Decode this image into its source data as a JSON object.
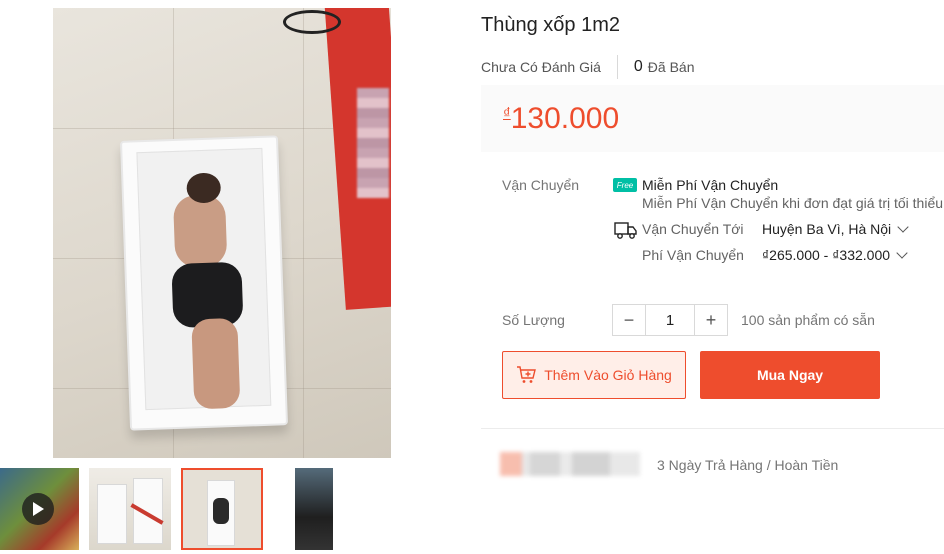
{
  "product": {
    "title": "Thùng xốp 1m2",
    "rating_text": "Chưa Có Đánh Giá",
    "sold_count": "0",
    "sold_label": "Đã Bán",
    "currency_symbol": "₫",
    "price": "130.000"
  },
  "shipping": {
    "label": "Vận Chuyển",
    "free_badge": "Free",
    "free_title": "Miễn Phí Vận Chuyển",
    "free_desc": "Miễn Phí Vận Chuyển khi đơn đạt giá trị tối thiểu",
    "ship_to_label": "Vận Chuyển Tới",
    "ship_to_value": "Huyện Ba Vì, Hà Nội",
    "fee_label": "Phí Vận Chuyển",
    "fee_value": "₫265.000 - ₫332.000"
  },
  "quantity": {
    "label": "Số Lượng",
    "value": "1",
    "minus": "−",
    "plus": "+",
    "stock_text": "100 sản phẩm có sẵn"
  },
  "actions": {
    "add_to_cart": "Thêm Vào Giỏ Hàng",
    "buy_now": "Mua Ngay"
  },
  "guarantee": {
    "text": "3 Ngày Trả Hàng / Hoàn Tiền"
  },
  "colors": {
    "accent": "#ee4d2d",
    "free_badge": "#00bfa5"
  }
}
